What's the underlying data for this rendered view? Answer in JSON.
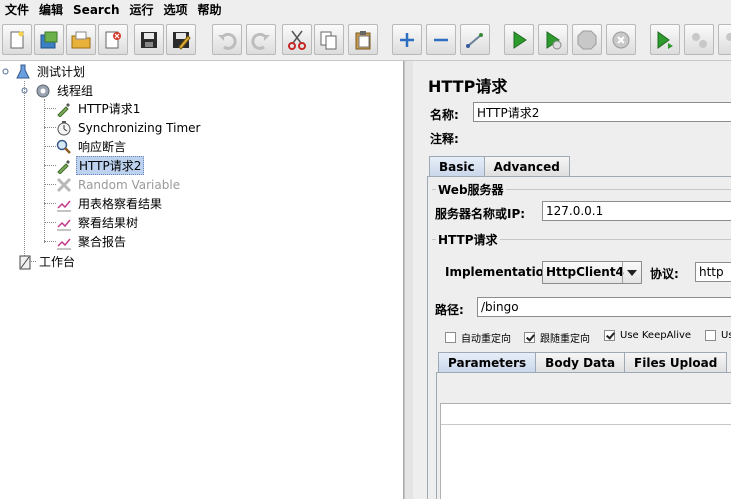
{
  "menu": [
    "文件",
    "编辑",
    "Search",
    "运行",
    "选项",
    "帮助"
  ],
  "toolbar": {
    "buttons": [
      {
        "name": "new-icon"
      },
      {
        "name": "templates-icon"
      },
      {
        "name": "open-icon"
      },
      {
        "name": "close-file-icon"
      },
      {
        "name": "save-icon"
      },
      {
        "name": "save-as-icon"
      },
      {
        "name": "undo-icon"
      },
      {
        "name": "redo-icon"
      },
      {
        "name": "cut-icon"
      },
      {
        "name": "copy-icon"
      },
      {
        "name": "paste-icon"
      },
      {
        "name": "expand-icon"
      },
      {
        "name": "collapse-icon"
      },
      {
        "name": "toggle-icon"
      },
      {
        "name": "start-icon"
      },
      {
        "name": "start-no-pause-icon"
      },
      {
        "name": "stop-icon"
      },
      {
        "name": "shutdown-icon"
      },
      {
        "name": "remote-start-icon"
      },
      {
        "name": "remote-stop-icon"
      },
      {
        "name": "remote-shutdown-icon"
      }
    ]
  },
  "tree": {
    "nodes": [
      {
        "label": "测试计划",
        "icon": "flask-icon"
      },
      {
        "label": "线程组",
        "icon": "gear-icon"
      },
      {
        "label": "HTTP请求1",
        "icon": "pipette-icon"
      },
      {
        "label": "Synchronizing Timer",
        "icon": "stopwatch-icon"
      },
      {
        "label": "响应断言",
        "icon": "magnifier-icon"
      },
      {
        "label": "HTTP请求2",
        "icon": "pipette-icon"
      },
      {
        "label": "Random Variable",
        "icon": "cross-icon"
      },
      {
        "label": "用表格察看结果",
        "icon": "graph-icon"
      },
      {
        "label": "察看结果树",
        "icon": "graph-icon"
      },
      {
        "label": "聚合报告",
        "icon": "graph-icon"
      },
      {
        "label": "工作台",
        "icon": "clipboard-icon"
      }
    ]
  },
  "panel": {
    "title": "HTTP请求",
    "name_label": "名称:",
    "name_value": "HTTP请求2",
    "comment_label": "注释:",
    "tabs": [
      "Basic",
      "Advanced"
    ],
    "web_server_group": "Web服务器",
    "server_label": "服务器名称或IP:",
    "server_value": "127.0.0.1",
    "http_request_group": "HTTP请求",
    "implementation_label": "Implementation:",
    "implementation_value": "HttpClient4",
    "protocol_label": "协议:",
    "protocol_value": "http",
    "path_label": "路径:",
    "path_value": "/bingo",
    "checkboxes": [
      {
        "label": "自动重定向",
        "checked": false
      },
      {
        "label": "跟随重定向",
        "checked": true
      },
      {
        "label": "Use KeepAlive",
        "checked": true
      },
      {
        "label": "Us",
        "checked": false
      }
    ],
    "sub_tabs": [
      "Parameters",
      "Body Data",
      "Files Upload"
    ]
  },
  "colors": {
    "selection": "#bcd2ee",
    "tab_active": "#c8d6ea",
    "background": "#eeeeee"
  }
}
